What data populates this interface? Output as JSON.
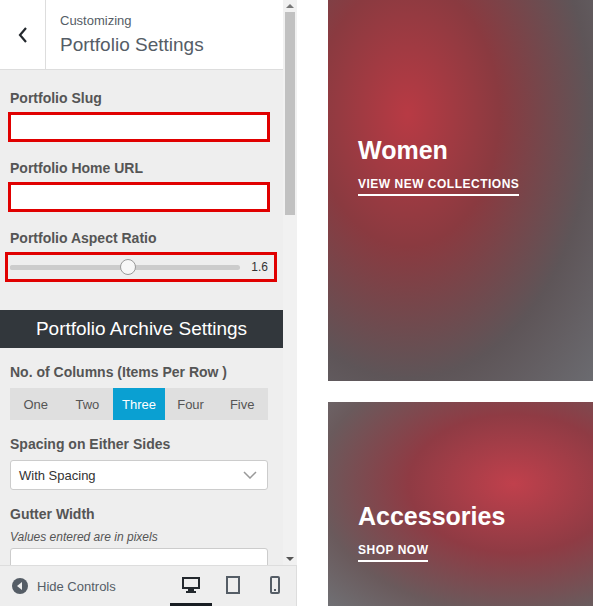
{
  "header": {
    "subtitle": "Customizing",
    "title": "Portfolio Settings"
  },
  "fields": [
    {
      "kind": "text",
      "label": "Portfolio Slug",
      "highlighted": true
    },
    {
      "kind": "text",
      "label": "Portfolio Home URL",
      "highlighted": true
    },
    {
      "kind": "slider",
      "label": "Portfolio Aspect Ratio",
      "level": 0.51,
      "reading": "1.6",
      "highlighted": true
    }
  ],
  "archive": {
    "title": "Portfolio Archive Settings",
    "columns": {
      "label": "No. of Columns (Items Per Row )",
      "options": [
        {
          "label": "One",
          "selected": false
        },
        {
          "label": "Two",
          "selected": false
        },
        {
          "label": "Three",
          "selected": true
        },
        {
          "label": "Four",
          "selected": false
        },
        {
          "label": "Five",
          "selected": false
        }
      ]
    },
    "spacing": {
      "label": "Spacing on Either Sides",
      "value": "With Spacing"
    },
    "gutter": {
      "label": "Gutter Width",
      "hint": "Values entered are in pixels"
    }
  },
  "footer": {
    "hide_controls": "Hide Controls",
    "devices": [
      {
        "kind": "desktop",
        "selected": true
      },
      {
        "kind": "tablet",
        "selected": false
      },
      {
        "kind": "mobile",
        "selected": false
      }
    ]
  },
  "preview": {
    "cards": [
      {
        "title": "Women",
        "link": "VIEW NEW COLLECTIONS"
      },
      {
        "title": "Accessories",
        "link": "SHOP NOW"
      }
    ]
  }
}
